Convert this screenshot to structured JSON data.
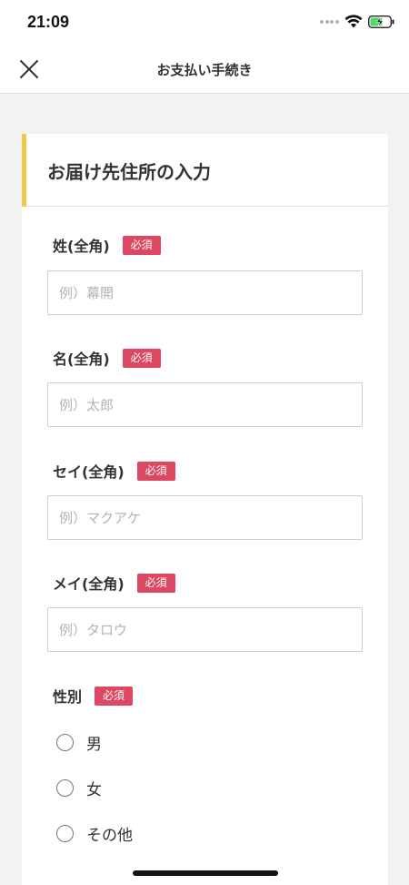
{
  "status_bar": {
    "time": "21:09"
  },
  "nav": {
    "title": "お支払い手続き",
    "close_icon": "close-icon"
  },
  "section": {
    "title": "お届け先住所の入力",
    "accent_color": "#f2c94c"
  },
  "required_badge": "必須",
  "required_color": "#dd4762",
  "fields": [
    {
      "label": "姓(全角)",
      "value": "",
      "placeholder": "例）幕開"
    },
    {
      "label": "名(全角)",
      "value": "",
      "placeholder": "例）太郎"
    },
    {
      "label": "セイ(全角)",
      "value": "",
      "placeholder": "例）マクアケ"
    },
    {
      "label": "メイ(全角)",
      "value": "",
      "placeholder": "例）タロウ"
    }
  ],
  "gender": {
    "label": "性別",
    "options": [
      "男",
      "女",
      "その他"
    ],
    "selected": null
  }
}
